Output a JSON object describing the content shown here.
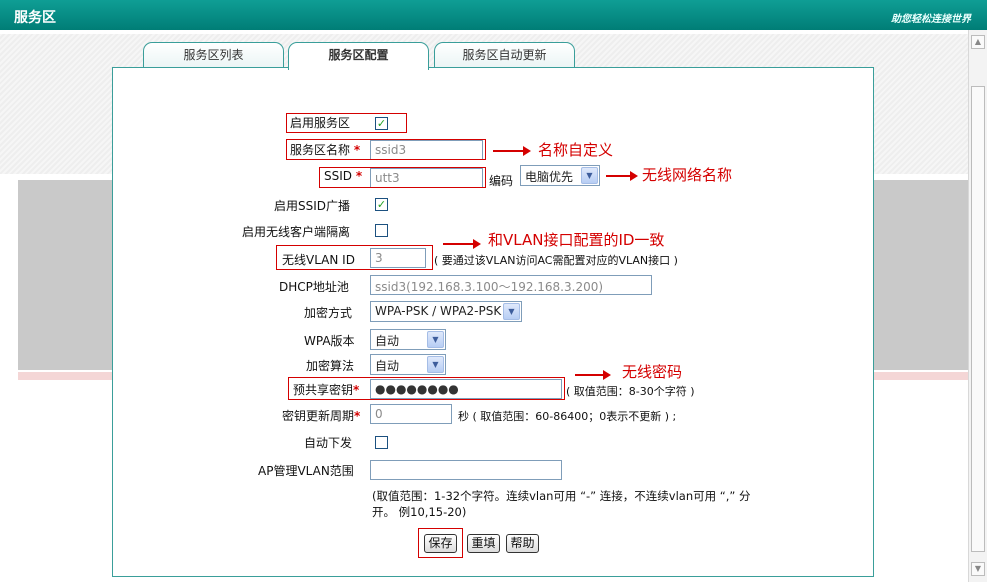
{
  "header": {
    "title": "服务区",
    "brand": "助您轻松连接世界"
  },
  "tabs": [
    {
      "label": "服务区列表"
    },
    {
      "label": "服务区配置"
    },
    {
      "label": "服务区自动更新"
    }
  ],
  "form": {
    "enable_service_label": "启用服务区",
    "name_label": "服务区名称",
    "name_value": "ssid3",
    "ssid_label": "SSID",
    "ssid_value": "utt3",
    "encoding_label": "编码",
    "encoding_value": "电脑优先",
    "broadcast_label": "启用SSID广播",
    "isolation_label": "启用无线客户端隔离",
    "vlan_label": "无线VLAN ID",
    "vlan_value": "3",
    "vlan_hint": "( 要通过该VLAN访问AC需配置对应的VLAN接口 )",
    "dhcp_label": "DHCP地址池",
    "dhcp_value": "ssid3(192.168.3.100～192.168.3.200)",
    "encrypt_label": "加密方式",
    "encrypt_value": "WPA-PSK / WPA2-PSK",
    "wpa_version_label": "WPA版本",
    "wpa_version_value": "自动",
    "algo_label": "加密算法",
    "algo_value": "自动",
    "psk_label": "预共享密钥",
    "psk_value": "●●●●●●●●",
    "psk_hint": "( 取值范围：8-30个字符 )",
    "rekey_label": "密钥更新周期",
    "rekey_value": "0",
    "rekey_hint": "秒 ( 取值范围：60-86400；0表示不更新 ) ;",
    "auto_issue_label": "自动下发",
    "ap_vlan_label": "AP管理VLAN范围",
    "ap_vlan_value": "",
    "ap_vlan_note_1": "(取值范围：1-32个字符。连续vlan可用 “-” 连接，不连续vlan可用 “,” 分",
    "ap_vlan_note_2": "开。 例10,15-20)",
    "required_mark": "*"
  },
  "buttons": {
    "save": "保存",
    "reset": "重填",
    "help": "帮助"
  },
  "annotations": {
    "name": "名称自定义",
    "ssid": "无线网络名称",
    "vlan": "和VLAN接口配置的ID一致",
    "psk": "无线密码"
  },
  "colors": {
    "header": "#0f9e95",
    "annotation": "#d40000",
    "border": "#3a9e9a"
  }
}
